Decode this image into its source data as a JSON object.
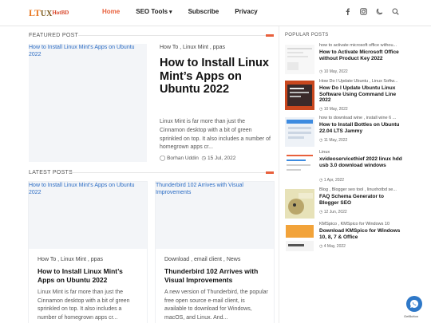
{
  "header": {
    "logo": {
      "part1": "LT",
      "part2": "UX",
      "part3": "HotBD"
    },
    "nav": [
      "Home",
      "SEO Tools",
      "Subscribe",
      "Privacy"
    ],
    "icons": [
      "facebook-icon",
      "instagram-icon",
      "moon-icon",
      "search-icon"
    ]
  },
  "featured": {
    "section_title": "FEATURED POST",
    "image_alt": "How to Install Linux Mint’s Apps on Ubuntu 2022",
    "tags": "How To , Linux Mint , ppas",
    "title": "How to Install Linux Mint’s Apps on Ubuntu 2022",
    "description": "Linux Mint is far more than just the Cinnamon desktop with a bit of green sprinkled on top. It also includes a number of homegrown apps cr...",
    "author": "Borhan Uddin",
    "date": "15 Jul, 2022"
  },
  "latest": {
    "section_title": "LATEST POSTS",
    "cards": [
      {
        "image_alt": "How to Install Linux Mint’s Apps on Ubuntu 2022",
        "tags": "How To , Linux Mint , ppas",
        "title": "How to Install Linux Mint’s Apps on Ubuntu 2022",
        "description": "Linux Mint is far more than just the Cinnamon desktop with a bit of green sprinkled on top. It also includes a number of homegrown apps cr..."
      },
      {
        "image_alt": "Thunderbird 102 Arrives with Visual Improvements",
        "tags": "Download , email client , News",
        "title": "Thunderbird 102 Arrives with Visual Improvements",
        "description": "A new version of Thunderbird, the popular free open source e-mail client, is available to download for Windows, macOS, and Linux. And..."
      }
    ]
  },
  "popular": {
    "section_title": "POPULAR POSTS",
    "items": [
      {
        "tags": "how to activate microsoft office withou...",
        "title": "How to Activate Microsoft Office without Product Key 2022",
        "date": "10 May, 2022"
      },
      {
        "tags": "How Do I Update Ubuntu , Linux Softw...",
        "title": "How Do I Update Ubuntu Linux Software Using Command Line 2022",
        "date": "10 May, 2022"
      },
      {
        "tags": "how to download wine , install wine 6 ...",
        "title": "How to Install Bottles on Ubuntu 22.04 LTS Jammy",
        "date": "11 May, 2022"
      },
      {
        "tags": "Linux",
        "title": "xvideoservicethief 2022 linux hdd usb 3.0 download windows",
        "date": "1 Apr, 2022"
      },
      {
        "tags": "Blog , Blogger seo tool , linuxhotbd se...",
        "title": "FAQ Schema Generator to Blogger SEO",
        "date": "12 Jun, 2022"
      },
      {
        "tags": "KMSpico , KMSpico for Windows 10",
        "title": "Download KMSpico for Windows 10, 8, 7 & Office",
        "date": "4 May, 2022"
      }
    ]
  },
  "float_button": {
    "label": "GetButton"
  },
  "colors": {
    "accent": "#e8603c",
    "link": "#2b6cc4",
    "fab": "#2e78c8"
  }
}
